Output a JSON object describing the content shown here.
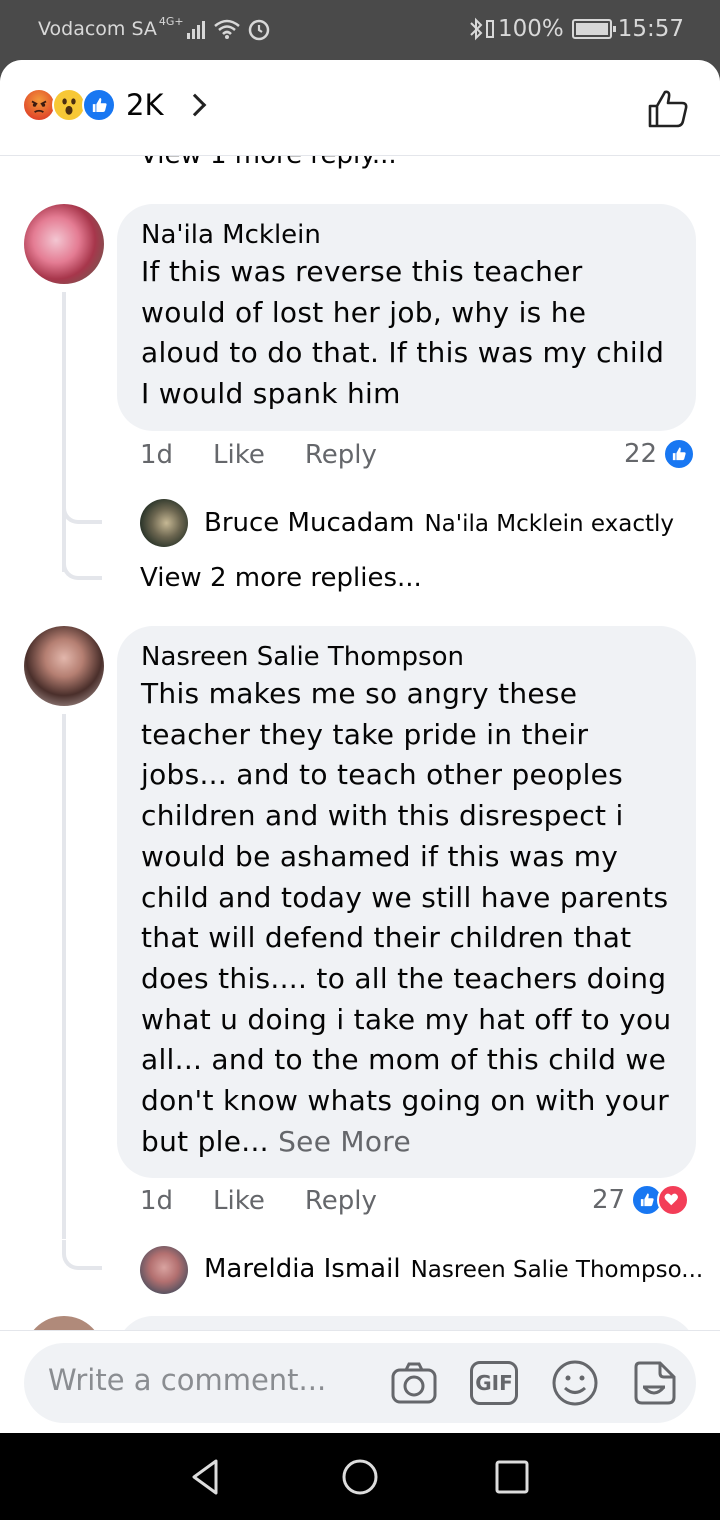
{
  "status_bar": {
    "carrier": "Vodacom SA",
    "network": "4G+",
    "battery": "100%",
    "time": "15:57"
  },
  "header": {
    "reaction_count": "2K",
    "reactions": [
      "angry-icon",
      "wow-icon",
      "like-icon"
    ]
  },
  "top_cutoff_text": "View 1 more reply...",
  "comments": [
    {
      "author": "Na'ila Mcklein",
      "text": "If this was reverse this teacher would of lost her job, why is he aloud to do that.  If this was my child I would spank him",
      "age": "1d",
      "like_label": "Like",
      "reply_label": "Reply",
      "reaction_count": "22",
      "replies": [
        {
          "author": "Bruce Mucadam",
          "text": "Na'ila Mcklein exactly"
        }
      ],
      "view_more": "View 2 more replies..."
    },
    {
      "author": "Nasreen Salie Thompson",
      "text": "This makes me so angry these teacher they take pride in their jobs... and to teach other peoples children and with this disrespect i would be ashamed if this was my child and today we still have parents that will defend their children that does this.... to all the teachers doing what u doing i take my hat off to you all... and to the mom of this child we don't know whats going on with your but ple...",
      "see_more": "See More",
      "age": "1d",
      "like_label": "Like",
      "reply_label": "Reply",
      "reaction_count": "27",
      "replies": [
        {
          "author": "Mareldia Ismail",
          "text": "Nasreen Salie Thompso..."
        }
      ]
    }
  ],
  "composer": {
    "placeholder": "Write a comment...",
    "icons": [
      "camera-icon",
      "gif-icon",
      "emoji-icon",
      "sticker-icon"
    ],
    "gif_label": "GIF"
  },
  "colors": {
    "accent": "#1877f2",
    "bubble": "#f0f2f5",
    "secondary_text": "#65676b",
    "love": "#f33e58"
  }
}
